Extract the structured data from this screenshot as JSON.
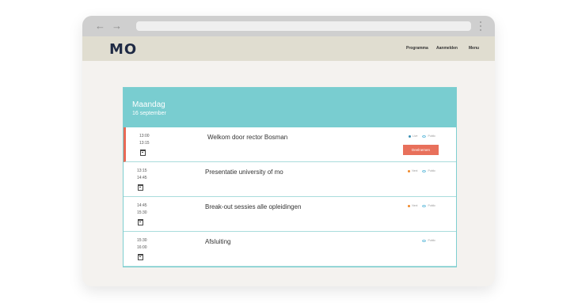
{
  "browser": {
    "back_icon": "back-arrow-icon",
    "back": "←",
    "forward_icon": "forward-arrow-icon",
    "forward": "→",
    "menu_icon": "kebab-menu-icon"
  },
  "site": {
    "logo": "MO",
    "nav": [
      "Programma",
      "Aanmelden",
      "Menu"
    ]
  },
  "day": {
    "title": "Maandag",
    "date": "16 september"
  },
  "sessions": [
    {
      "start": "13:00",
      "end": "13:15",
      "title": "Welkom door rector Bosman",
      "tags": [
        {
          "label": "Live",
          "color": "#3a8fb3",
          "kind": "dot"
        },
        {
          "label": "Public",
          "color": "#6ec0de",
          "kind": "eye"
        }
      ],
      "button": "Deelnemen"
    },
    {
      "start": "13:15",
      "end": "14:45",
      "title": "Presentatie university of mo",
      "tags": [
        {
          "label": "Next",
          "color": "#f0892a",
          "kind": "dot"
        },
        {
          "label": "Public",
          "color": "#6ec0de",
          "kind": "eye"
        }
      ]
    },
    {
      "start": "14:45",
      "end": "15:30",
      "title": "Break-out sessies alle opleidingen",
      "tags": [
        {
          "label": "Next",
          "color": "#f0892a",
          "kind": "dot"
        },
        {
          "label": "Public",
          "color": "#6ec0de",
          "kind": "eye"
        }
      ]
    },
    {
      "start": "15:30",
      "end": "16:00",
      "title": "Afsluiting",
      "tags": [
        {
          "label": "Public",
          "color": "#6ec0de",
          "kind": "eye"
        }
      ]
    }
  ]
}
